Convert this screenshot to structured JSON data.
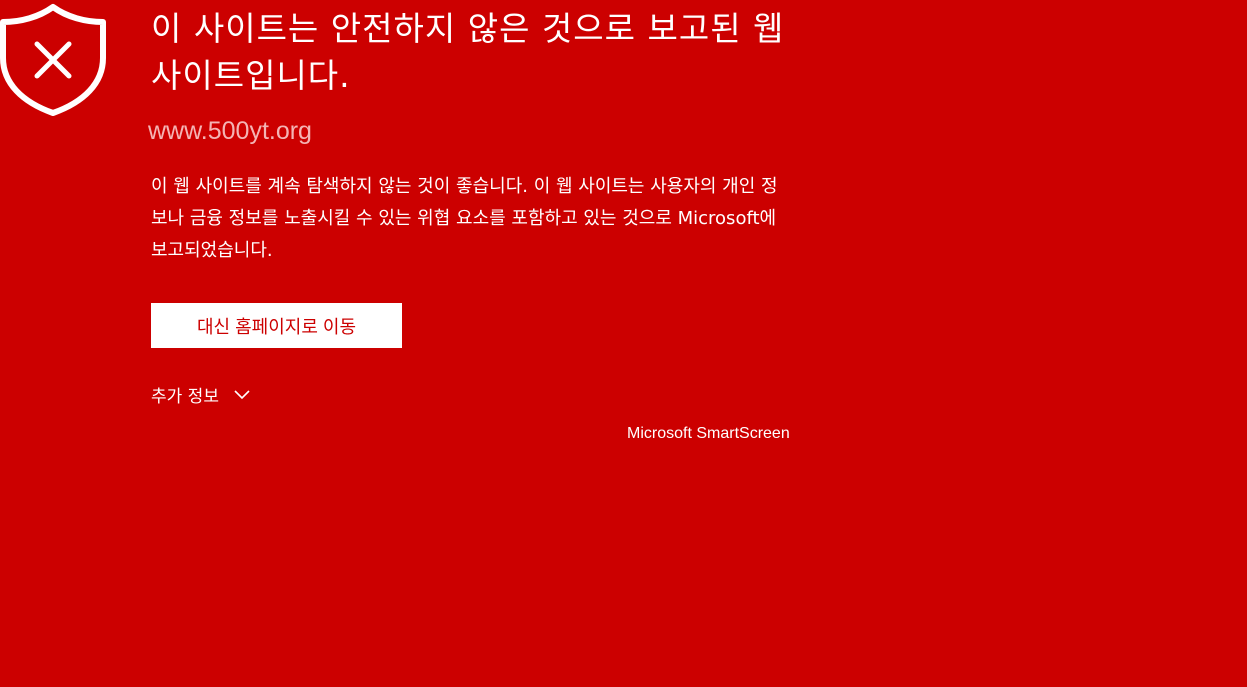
{
  "warning": {
    "shield_icon": "shield-x-icon",
    "title": "이 사이트는 안전하지 않은 것으로 보고된 웹 사이트입니다.",
    "url": "www.500yt.org",
    "description": "이 웹 사이트를 계속 탐색하지 않는 것이 좋습니다. 이 웹 사이트는 사용자의 개인 정보나 금융 정보를 노출시킬 수 있는 위협 요소를 포함하고 있는 것으로 Microsoft에 보고되었습니다.",
    "home_button_label": "대신 홈페이지로 이동",
    "more_info_label": "추가 정보",
    "more_info_icon": "chevron-down-icon",
    "branding": "Microsoft SmartScreen"
  },
  "colors": {
    "background": "#cc0000",
    "text": "#ffffff",
    "url_text": "#f4b4b4",
    "button_background": "#ffffff",
    "button_text": "#cc0000"
  }
}
